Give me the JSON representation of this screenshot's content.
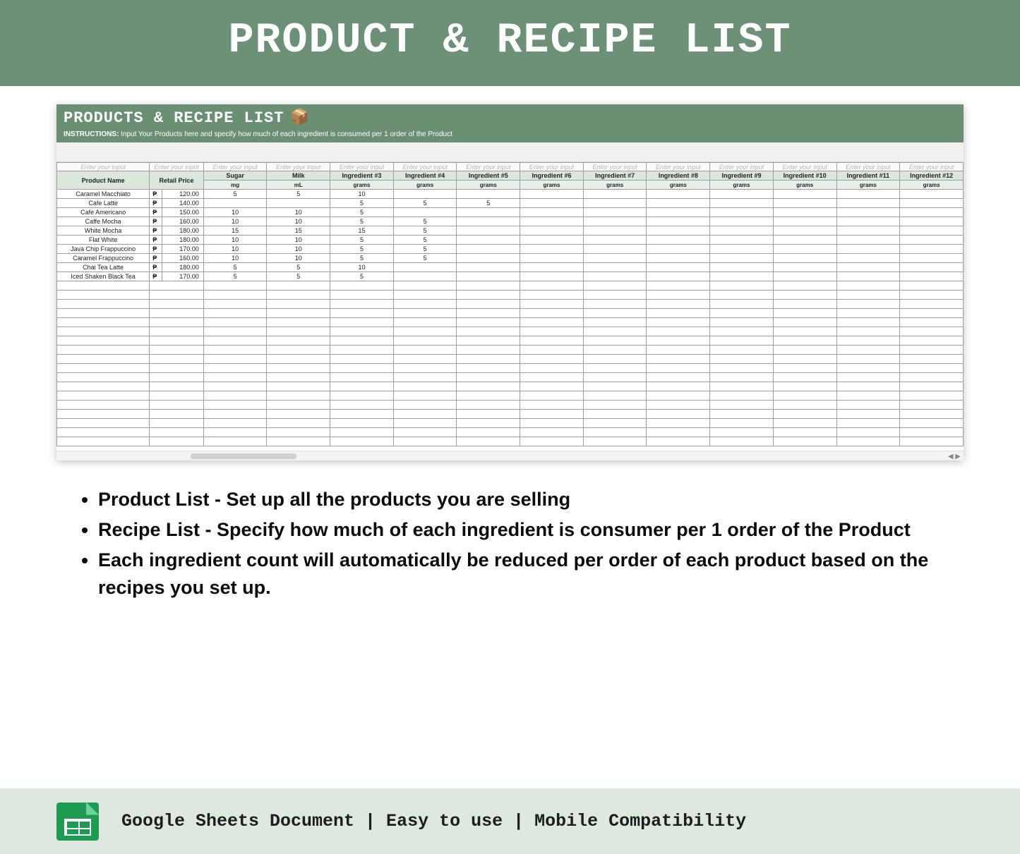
{
  "banner": {
    "title": "PRODUCT & RECIPE LIST"
  },
  "sheet": {
    "title": "PRODUCTS & RECIPE LIST",
    "emoji": "📦",
    "instructions_label": "INSTRUCTIONS:",
    "instructions_text": "Input Your Products here and specify how much of each ingredient is consumed per 1 order of the Product",
    "hint_text": "Enter your input",
    "headers": {
      "product": "Product Name",
      "price": "Retail Price"
    },
    "currency": "₱",
    "ingredients": [
      {
        "name": "Sugar",
        "unit": "mg"
      },
      {
        "name": "Milk",
        "unit": "mL"
      },
      {
        "name": "Ingredient #3",
        "unit": "grams"
      },
      {
        "name": "Ingredient #4",
        "unit": "grams"
      },
      {
        "name": "Ingredient #5",
        "unit": "grams"
      },
      {
        "name": "Ingredient #6",
        "unit": "grams"
      },
      {
        "name": "Ingredient #7",
        "unit": "grams"
      },
      {
        "name": "Ingredient #8",
        "unit": "grams"
      },
      {
        "name": "Ingredient #9",
        "unit": "grams"
      },
      {
        "name": "Ingredient #10",
        "unit": "grams"
      },
      {
        "name": "Ingredient #11",
        "unit": "grams"
      },
      {
        "name": "Ingredient #12",
        "unit": "grams"
      }
    ],
    "rows": [
      {
        "name": "Caramel Macchiato",
        "price": "120.00",
        "vals": [
          "5",
          "5",
          "10",
          "",
          "",
          "",
          "",
          "",
          "",
          "",
          "",
          ""
        ]
      },
      {
        "name": "Cafe Latte",
        "price": "140.00",
        "vals": [
          "",
          "",
          "5",
          "5",
          "5",
          "",
          "",
          "",
          "",
          "",
          "",
          ""
        ]
      },
      {
        "name": "Cafe Americano",
        "price": "150.00",
        "vals": [
          "10",
          "10",
          "5",
          "",
          "",
          "",
          "",
          "",
          "",
          "",
          "",
          ""
        ]
      },
      {
        "name": "Caffe Mocha",
        "price": "160.00",
        "vals": [
          "10",
          "10",
          "5",
          "5",
          "",
          "",
          "",
          "",
          "",
          "",
          "",
          ""
        ]
      },
      {
        "name": "White Mocha",
        "price": "180.00",
        "vals": [
          "15",
          "15",
          "15",
          "5",
          "",
          "",
          "",
          "",
          "",
          "",
          "",
          ""
        ]
      },
      {
        "name": "Flat White",
        "price": "180.00",
        "vals": [
          "10",
          "10",
          "5",
          "5",
          "",
          "",
          "",
          "",
          "",
          "",
          "",
          ""
        ]
      },
      {
        "name": "Java Chip Frappuccino",
        "price": "170.00",
        "vals": [
          "10",
          "10",
          "5",
          "5",
          "",
          "",
          "",
          "",
          "",
          "",
          "",
          ""
        ]
      },
      {
        "name": "Caramel Frappuccino",
        "price": "160.00",
        "vals": [
          "10",
          "10",
          "5",
          "5",
          "",
          "",
          "",
          "",
          "",
          "",
          "",
          ""
        ]
      },
      {
        "name": "Chai Tea Latte",
        "price": "180.00",
        "vals": [
          "5",
          "5",
          "10",
          "",
          "",
          "",
          "",
          "",
          "",
          "",
          "",
          ""
        ]
      },
      {
        "name": "Iced Shaken Black Tea",
        "price": "170.00",
        "vals": [
          "5",
          "5",
          "5",
          "",
          "",
          "",
          "",
          "",
          "",
          "",
          "",
          ""
        ]
      }
    ],
    "empty_row_count": 18
  },
  "bullets": [
    "Product List - Set up all the products you are selling",
    "Recipe List - Specify how much of each ingredient is consumer per 1 order of the Product",
    "Each ingredient count will automatically be reduced per order of each product based on the recipes you set up."
  ],
  "footer": {
    "items": [
      "Google Sheets Document",
      "Easy to use",
      "Mobile Compatibility"
    ],
    "sep": "  |  "
  }
}
